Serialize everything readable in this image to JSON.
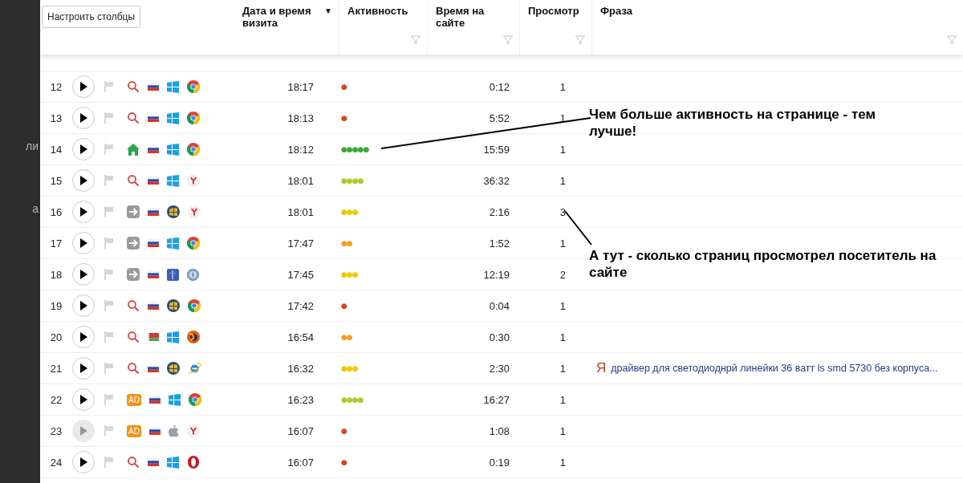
{
  "sidebar": {
    "fragments": [
      "ли",
      "а"
    ]
  },
  "toolbar": {
    "columns_button": "Настроить столбцы"
  },
  "table": {
    "columns": [
      {
        "title": "Дата и время визита",
        "sort": "▼",
        "filter": false
      },
      {
        "title": "Активность",
        "filter": true
      },
      {
        "title": "Время на сайте",
        "filter": true
      },
      {
        "title": "Просмотр",
        "filter": true
      },
      {
        "title": "Фраза",
        "filter": true
      }
    ],
    "rows": [
      {
        "number": "12",
        "disabled": false,
        "icons": [
          {
            "kind": "search"
          },
          {
            "kind": "flag_ru"
          },
          {
            "kind": "windows"
          },
          {
            "kind": "chrome"
          }
        ],
        "time": "18:17",
        "activity": {
          "dots": "●",
          "color": "#e2401f"
        },
        "duration": "0:12",
        "views": "1"
      },
      {
        "number": "13",
        "disabled": false,
        "icons": [
          {
            "kind": "search"
          },
          {
            "kind": "flag_ru"
          },
          {
            "kind": "windows"
          },
          {
            "kind": "chrome"
          }
        ],
        "time": "18:13",
        "activity": {
          "dots": "●",
          "color": "#e2401f"
        },
        "duration": "5:52",
        "views": "1"
      },
      {
        "number": "14",
        "disabled": false,
        "icons": [
          {
            "kind": "home"
          },
          {
            "kind": "flag_ru"
          },
          {
            "kind": "windows"
          },
          {
            "kind": "chrome"
          }
        ],
        "time": "18:12",
        "activity": {
          "dots": "●●●●●",
          "color": "#3aa834"
        },
        "duration": "15:59",
        "views": "1"
      },
      {
        "number": "15",
        "disabled": false,
        "icons": [
          {
            "kind": "search"
          },
          {
            "kind": "flag_ru"
          },
          {
            "kind": "windows"
          },
          {
            "kind": "yandex"
          }
        ],
        "time": "18:01",
        "activity": {
          "dots": "●●●●",
          "color": "#a9cc2c"
        },
        "duration": "36:32",
        "views": "1"
      },
      {
        "number": "16",
        "disabled": false,
        "icons": [
          {
            "kind": "link"
          },
          {
            "kind": "flag_ru"
          },
          {
            "kind": "win7"
          },
          {
            "kind": "yandex"
          }
        ],
        "time": "18:01",
        "activity": {
          "dots": "●●●",
          "color": "#f2c900"
        },
        "duration": "2:16",
        "views": "3"
      },
      {
        "number": "17",
        "disabled": false,
        "icons": [
          {
            "kind": "link"
          },
          {
            "kind": "flag_ru"
          },
          {
            "kind": "windows"
          },
          {
            "kind": "chrome"
          }
        ],
        "time": "17:47",
        "activity": {
          "dots": "●●",
          "color": "#f0a020"
        },
        "duration": "1:52",
        "views": "1"
      },
      {
        "number": "18",
        "disabled": false,
        "icons": [
          {
            "kind": "link"
          },
          {
            "kind": "flag_ru"
          },
          {
            "kind": "mac"
          },
          {
            "kind": "safari"
          }
        ],
        "time": "17:45",
        "activity": {
          "dots": "●●●",
          "color": "#f2c900"
        },
        "duration": "12:19",
        "views": "2"
      },
      {
        "number": "19",
        "disabled": false,
        "icons": [
          {
            "kind": "search"
          },
          {
            "kind": "flag_ru"
          },
          {
            "kind": "win7"
          },
          {
            "kind": "chrome"
          }
        ],
        "time": "17:42",
        "activity": {
          "dots": "●",
          "color": "#e2401f"
        },
        "duration": "0:04",
        "views": "1"
      },
      {
        "number": "20",
        "disabled": false,
        "icons": [
          {
            "kind": "search"
          },
          {
            "kind": "flag_by"
          },
          {
            "kind": "windows"
          },
          {
            "kind": "firefox"
          }
        ],
        "time": "16:54",
        "activity": {
          "dots": "●●",
          "color": "#f0a020"
        },
        "duration": "0:30",
        "views": "1"
      },
      {
        "number": "21",
        "disabled": false,
        "icons": [
          {
            "kind": "search"
          },
          {
            "kind": "flag_ru"
          },
          {
            "kind": "win7"
          },
          {
            "kind": "ie"
          }
        ],
        "time": "16:32",
        "activity": {
          "dots": "●●●",
          "color": "#f2c900"
        },
        "duration": "2:30",
        "views": "1",
        "phrase": {
          "engine_mark": "Я",
          "text": "драйвер для светодиоднрй линейки 36 ватт ls smd 5730 без корпуса..."
        }
      },
      {
        "number": "22",
        "disabled": false,
        "icons": [
          {
            "kind": "ad",
            "label": "AD"
          },
          {
            "kind": "flag_ru"
          },
          {
            "kind": "windows"
          },
          {
            "kind": "chrome"
          }
        ],
        "time": "16:23",
        "activity": {
          "dots": "●●●●",
          "color": "#a9cc2c"
        },
        "duration": "16:27",
        "views": "1"
      },
      {
        "number": "23",
        "disabled": true,
        "icons": [
          {
            "kind": "ad",
            "label": "AD"
          },
          {
            "kind": "flag_ru"
          },
          {
            "kind": "apple"
          },
          {
            "kind": "yandex"
          }
        ],
        "time": "16:07",
        "activity": {
          "dots": "●",
          "color": "#e2401f"
        },
        "duration": "1:08",
        "views": "1"
      },
      {
        "number": "24",
        "disabled": false,
        "icons": [
          {
            "kind": "search"
          },
          {
            "kind": "flag_ru"
          },
          {
            "kind": "windows"
          },
          {
            "kind": "opera"
          }
        ],
        "time": "16:07",
        "activity": {
          "dots": "●",
          "color": "#e2401f"
        },
        "duration": "0:19",
        "views": "1"
      }
    ]
  },
  "annotations": [
    {
      "text": "Чем больше активность на странице - тем лучше!"
    },
    {
      "text": "А тут - сколько страниц просмотрел посетитель на сайте"
    }
  ]
}
